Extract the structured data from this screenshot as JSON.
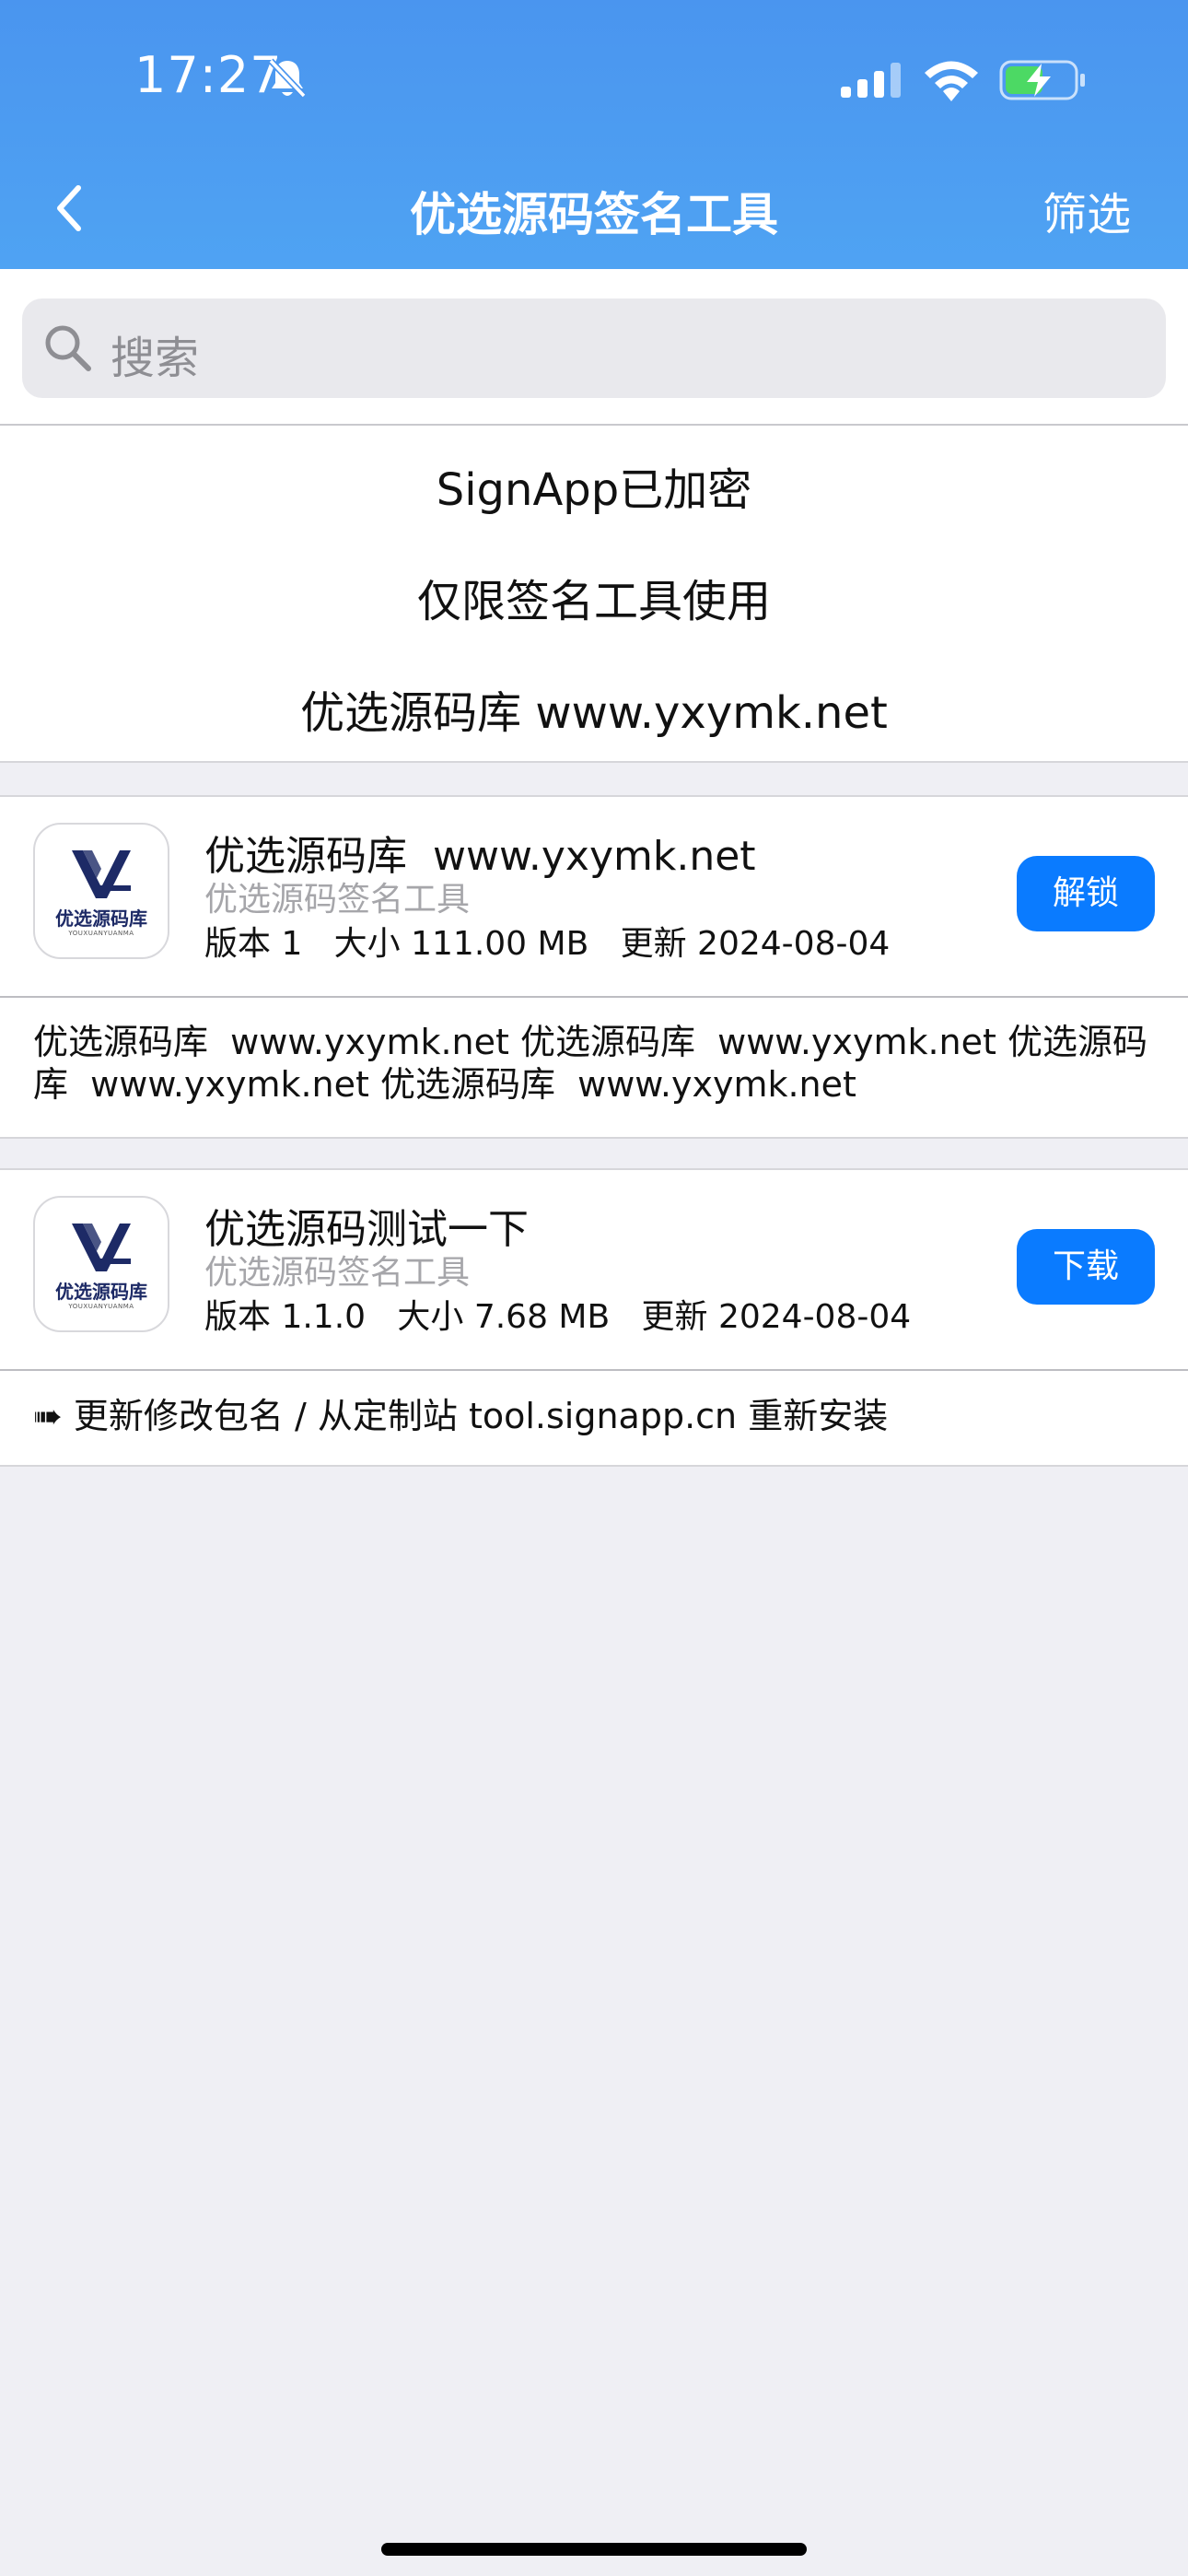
{
  "status_bar": {
    "time": "17:27"
  },
  "nav": {
    "title": "优选源码签名工具",
    "filter_label": "筛选"
  },
  "search": {
    "placeholder": "搜索"
  },
  "notice": {
    "line1": "SignApp已加密",
    "line2": "仅限签名工具使用",
    "line3": "优选源码库  www.yxymk.net"
  },
  "apps": [
    {
      "icon_text": "优选源码库",
      "icon_subtext": "YOUXUANYUANMA",
      "name": "优选源码库  www.yxymk.net",
      "subtitle": "优选源码签名工具",
      "meta": "版本 1   大小 111.00 MB   更新 2024-08-04",
      "button_label": "解锁",
      "description": "优选源码库  www.yxymk.net 优选源码库  www.yxymk.net 优选源码库  www.yxymk.net 优选源码库  www.yxymk.net"
    },
    {
      "icon_text": "优选源码库",
      "icon_subtext": "YOUXUANYUANMA",
      "name": "优选源码测试一下",
      "subtitle": "优选源码签名工具",
      "meta": "版本 1.1.0   大小 7.68 MB   更新 2024-08-04",
      "button_label": "下载",
      "description": "➠ 更新修改包名 / 从定制站 tool.signapp.cn 重新安装"
    }
  ],
  "icons": {
    "back": "chevron-left-icon",
    "bell": "bell-slash-icon",
    "signal": "cellular-signal-icon",
    "wifi": "wifi-icon",
    "battery": "battery-charging-icon",
    "search": "search-icon"
  },
  "colors": {
    "header": "#4a95ef",
    "button": "#0a7bff",
    "background": "#efeff4",
    "logo": "#1d2a66"
  }
}
